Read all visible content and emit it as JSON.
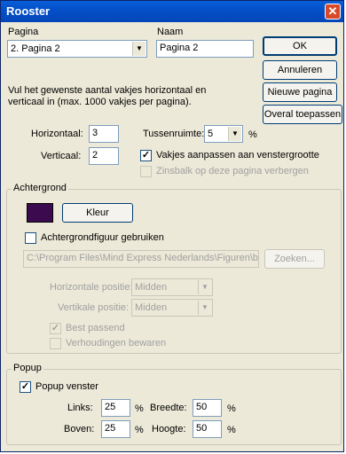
{
  "window": {
    "title": "Rooster",
    "close_glyph": "✕"
  },
  "pagina": {
    "label": "Pagina",
    "value": "2. Pagina 2"
  },
  "naam": {
    "label": "Naam",
    "value": "Pagina 2"
  },
  "buttons": {
    "ok": "OK",
    "annuleren": "Annuleren",
    "nieuwe_pagina": "Nieuwe pagina",
    "overal": "Overal toepassen"
  },
  "instructions": {
    "line1": "Vul het gewenste aantal vakjes horizontaal en",
    "line2": "verticaal in (max. 1000 vakjes per pagina)."
  },
  "horizontaal": {
    "label": "Horizontaal:",
    "value": "3"
  },
  "verticaal": {
    "label": "Verticaal:",
    "value": "2"
  },
  "tussenruimte": {
    "label": "Tussenruimte:",
    "value": "5",
    "unit": "%"
  },
  "vakjes_aanpassen": {
    "label": "Vakjes aanpassen aan venstergrootte",
    "checked": true
  },
  "zinsbalk": {
    "label": "Zinsbalk op deze pagina verbergen",
    "checked": false
  },
  "achtergrond": {
    "group_label": "Achtergrond",
    "swatch_color": "#3c0a4e",
    "kleur_button": "Kleur",
    "figuur_label": "Achtergrondfiguur gebruiken",
    "path": "C:\\Program Files\\Mind Express Nederlands\\Figuren\\b",
    "zoeken_button": "Zoeken...",
    "hor_pos_label": "Horizontale positie:",
    "hor_pos_value": "Midden",
    "vert_pos_label": "Vertikale positie:",
    "vert_pos_value": "Midden",
    "best_passend": "Best passend",
    "verhoudingen": "Verhoudingen bewaren"
  },
  "popup": {
    "group_label": "Popup",
    "venster_label": "Popup venster",
    "links_label": "Links:",
    "links_value": "25",
    "breedte_label": "Breedte:",
    "breedte_value": "50",
    "boven_label": "Boven:",
    "boven_value": "25",
    "hoogte_label": "Hoogte:",
    "hoogte_value": "50",
    "unit": "%"
  },
  "checkmark": "✓",
  "dropdown_arrow": "▼"
}
